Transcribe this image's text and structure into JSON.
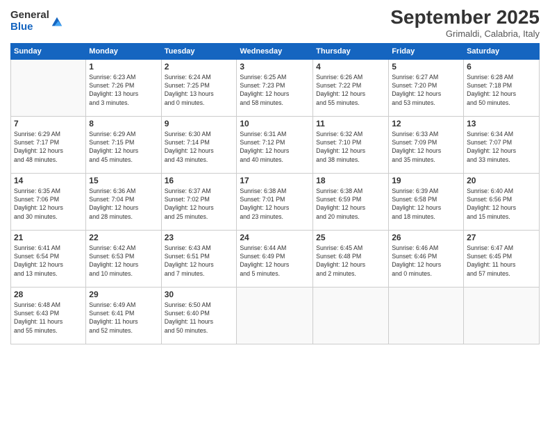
{
  "logo": {
    "general": "General",
    "blue": "Blue"
  },
  "title": "September 2025",
  "location": "Grimaldi, Calabria, Italy",
  "days_of_week": [
    "Sunday",
    "Monday",
    "Tuesday",
    "Wednesday",
    "Thursday",
    "Friday",
    "Saturday"
  ],
  "weeks": [
    [
      {
        "day": "",
        "info": ""
      },
      {
        "day": "1",
        "info": "Sunrise: 6:23 AM\nSunset: 7:26 PM\nDaylight: 13 hours\nand 3 minutes."
      },
      {
        "day": "2",
        "info": "Sunrise: 6:24 AM\nSunset: 7:25 PM\nDaylight: 13 hours\nand 0 minutes."
      },
      {
        "day": "3",
        "info": "Sunrise: 6:25 AM\nSunset: 7:23 PM\nDaylight: 12 hours\nand 58 minutes."
      },
      {
        "day": "4",
        "info": "Sunrise: 6:26 AM\nSunset: 7:22 PM\nDaylight: 12 hours\nand 55 minutes."
      },
      {
        "day": "5",
        "info": "Sunrise: 6:27 AM\nSunset: 7:20 PM\nDaylight: 12 hours\nand 53 minutes."
      },
      {
        "day": "6",
        "info": "Sunrise: 6:28 AM\nSunset: 7:18 PM\nDaylight: 12 hours\nand 50 minutes."
      }
    ],
    [
      {
        "day": "7",
        "info": "Sunrise: 6:29 AM\nSunset: 7:17 PM\nDaylight: 12 hours\nand 48 minutes."
      },
      {
        "day": "8",
        "info": "Sunrise: 6:29 AM\nSunset: 7:15 PM\nDaylight: 12 hours\nand 45 minutes."
      },
      {
        "day": "9",
        "info": "Sunrise: 6:30 AM\nSunset: 7:14 PM\nDaylight: 12 hours\nand 43 minutes."
      },
      {
        "day": "10",
        "info": "Sunrise: 6:31 AM\nSunset: 7:12 PM\nDaylight: 12 hours\nand 40 minutes."
      },
      {
        "day": "11",
        "info": "Sunrise: 6:32 AM\nSunset: 7:10 PM\nDaylight: 12 hours\nand 38 minutes."
      },
      {
        "day": "12",
        "info": "Sunrise: 6:33 AM\nSunset: 7:09 PM\nDaylight: 12 hours\nand 35 minutes."
      },
      {
        "day": "13",
        "info": "Sunrise: 6:34 AM\nSunset: 7:07 PM\nDaylight: 12 hours\nand 33 minutes."
      }
    ],
    [
      {
        "day": "14",
        "info": "Sunrise: 6:35 AM\nSunset: 7:06 PM\nDaylight: 12 hours\nand 30 minutes."
      },
      {
        "day": "15",
        "info": "Sunrise: 6:36 AM\nSunset: 7:04 PM\nDaylight: 12 hours\nand 28 minutes."
      },
      {
        "day": "16",
        "info": "Sunrise: 6:37 AM\nSunset: 7:02 PM\nDaylight: 12 hours\nand 25 minutes."
      },
      {
        "day": "17",
        "info": "Sunrise: 6:38 AM\nSunset: 7:01 PM\nDaylight: 12 hours\nand 23 minutes."
      },
      {
        "day": "18",
        "info": "Sunrise: 6:38 AM\nSunset: 6:59 PM\nDaylight: 12 hours\nand 20 minutes."
      },
      {
        "day": "19",
        "info": "Sunrise: 6:39 AM\nSunset: 6:58 PM\nDaylight: 12 hours\nand 18 minutes."
      },
      {
        "day": "20",
        "info": "Sunrise: 6:40 AM\nSunset: 6:56 PM\nDaylight: 12 hours\nand 15 minutes."
      }
    ],
    [
      {
        "day": "21",
        "info": "Sunrise: 6:41 AM\nSunset: 6:54 PM\nDaylight: 12 hours\nand 13 minutes."
      },
      {
        "day": "22",
        "info": "Sunrise: 6:42 AM\nSunset: 6:53 PM\nDaylight: 12 hours\nand 10 minutes."
      },
      {
        "day": "23",
        "info": "Sunrise: 6:43 AM\nSunset: 6:51 PM\nDaylight: 12 hours\nand 7 minutes."
      },
      {
        "day": "24",
        "info": "Sunrise: 6:44 AM\nSunset: 6:49 PM\nDaylight: 12 hours\nand 5 minutes."
      },
      {
        "day": "25",
        "info": "Sunrise: 6:45 AM\nSunset: 6:48 PM\nDaylight: 12 hours\nand 2 minutes."
      },
      {
        "day": "26",
        "info": "Sunrise: 6:46 AM\nSunset: 6:46 PM\nDaylight: 12 hours\nand 0 minutes."
      },
      {
        "day": "27",
        "info": "Sunrise: 6:47 AM\nSunset: 6:45 PM\nDaylight: 11 hours\nand 57 minutes."
      }
    ],
    [
      {
        "day": "28",
        "info": "Sunrise: 6:48 AM\nSunset: 6:43 PM\nDaylight: 11 hours\nand 55 minutes."
      },
      {
        "day": "29",
        "info": "Sunrise: 6:49 AM\nSunset: 6:41 PM\nDaylight: 11 hours\nand 52 minutes."
      },
      {
        "day": "30",
        "info": "Sunrise: 6:50 AM\nSunset: 6:40 PM\nDaylight: 11 hours\nand 50 minutes."
      },
      {
        "day": "",
        "info": ""
      },
      {
        "day": "",
        "info": ""
      },
      {
        "day": "",
        "info": ""
      },
      {
        "day": "",
        "info": ""
      }
    ]
  ]
}
